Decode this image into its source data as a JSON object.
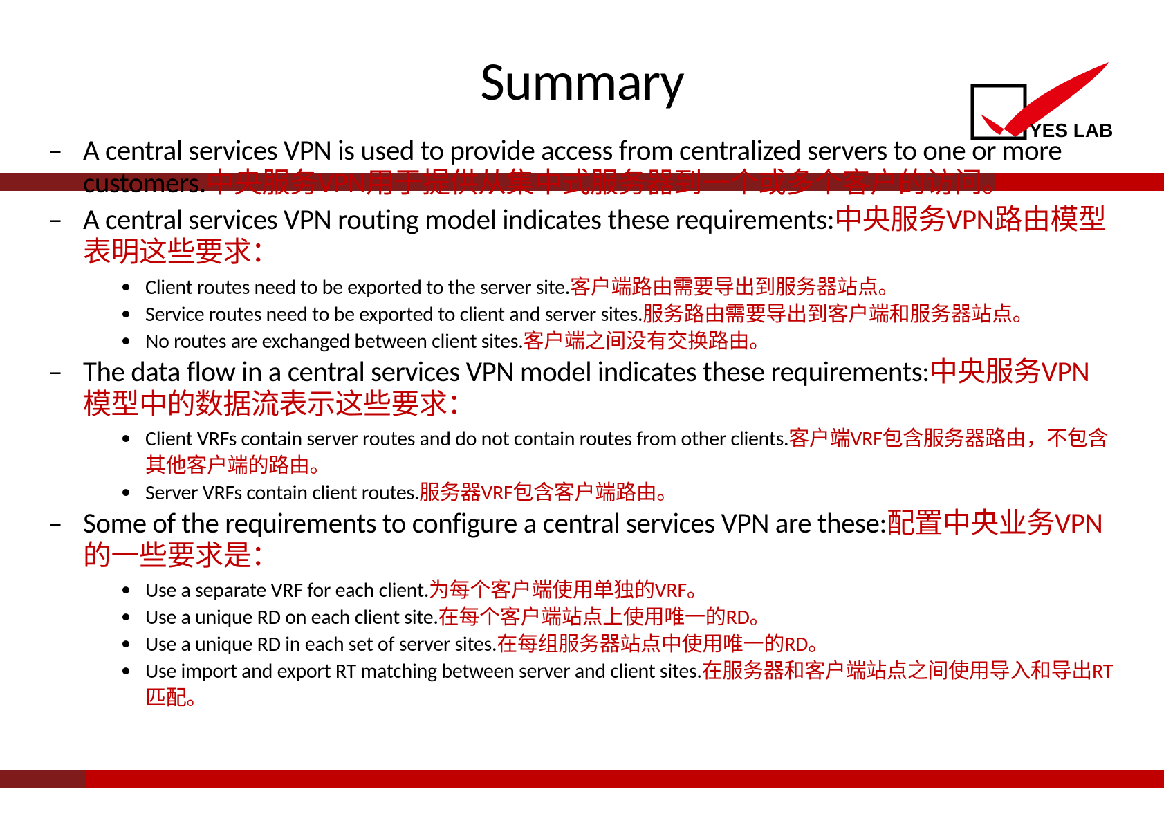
{
  "title": "Summary",
  "logo_text": "YES LAB",
  "items": [
    {
      "en": "A central services VPN is used to provide access from  centralized servers to one or more customers.",
      "cn": "中央服务VPN用于提供从集中式服务器到一个或多个客户的访问。",
      "subs": []
    },
    {
      "en": "A central services VPN routing model indicates these requirements:",
      "cn": "中央服务VPN路由模型表明这些要求：",
      "subs": [
        {
          "en": "Client routes need to be exported to the server site.",
          "cn": "客户端路由需要导出到服务器站点。"
        },
        {
          "en": "Service routes need to be exported to client and server sites.",
          "cn": "服务路由需要导出到客户端和服务器站点。"
        },
        {
          "en": "No routes are exchanged between client sites.",
          "cn": "客户端之间没有交换路由。"
        }
      ]
    },
    {
      "en": "The data flow in a central services VPN model indicates these requirements:",
      "cn": "中央服务VPN模型中的数据流表示这些要求：",
      "subs": [
        {
          "en": "Client VRFs contain server routes and do not contain routes from other clients.",
          "cn": "客户端VRF包含服务器路由，不包含其他客户端的路由。"
        },
        {
          "en": "Server VRFs contain client routes.",
          "cn": "服务器VRF包含客户端路由。"
        }
      ]
    },
    {
      "en": "Some of the requirements to configure a central services  VPN are these:",
      "cn": "配置中央业务VPN的一些要求是：",
      "subs": [
        {
          "en": "Use a separate VRF for each client.",
          "cn": "为每个客户端使用单独的VRF。"
        },
        {
          "en": "Use a unique RD on each client site.",
          "cn": "在每个客户端站点上使用唯一的RD。"
        },
        {
          "en": "Use a unique RD in each set of server sites.",
          "cn": "在每组服务器站点中使用唯一的RD。"
        },
        {
          "en": "Use import and export RT matching between server and client sites.",
          "cn": "在服务器和客户端站点之间使用导入和导出RT匹配。"
        }
      ]
    }
  ]
}
